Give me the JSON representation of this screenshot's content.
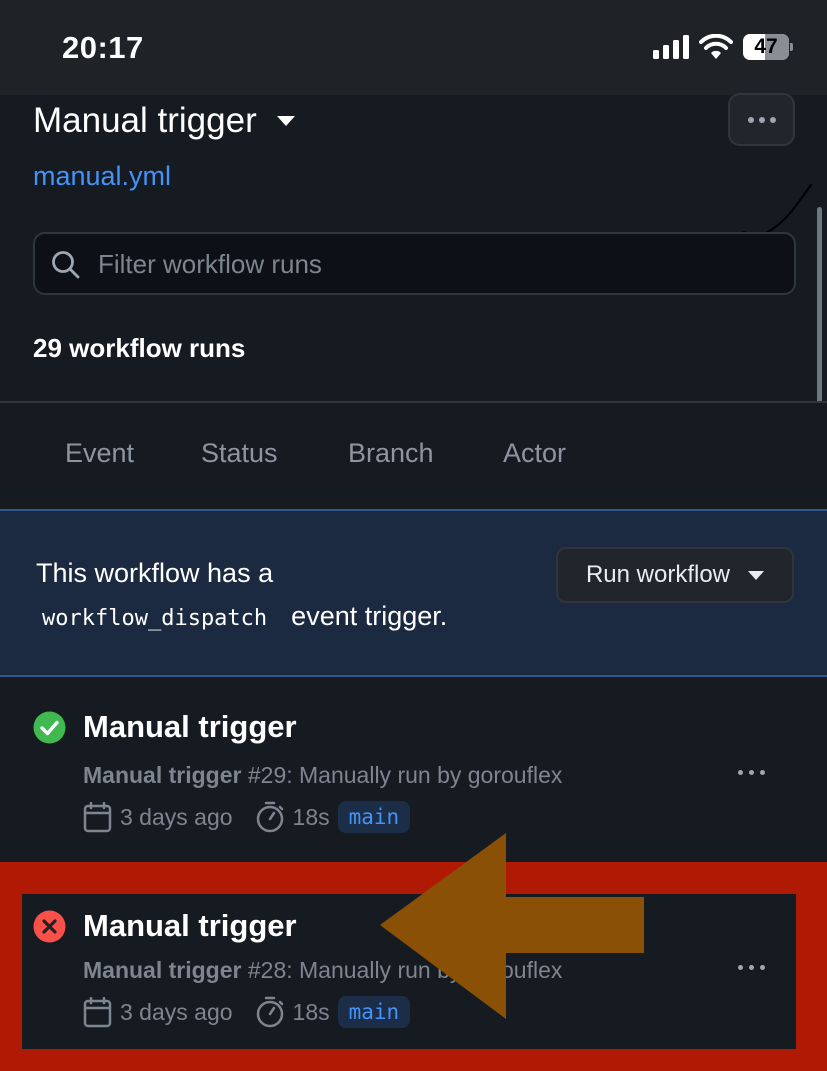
{
  "status_bar": {
    "time": "20:17",
    "battery": "47"
  },
  "header": {
    "title": "Manual trigger",
    "file_link": "manual.yml",
    "search": {
      "placeholder": "Filter workflow runs",
      "value": ""
    },
    "runs_count": "29 workflow runs"
  },
  "filters": [
    "Event",
    "Status",
    "Branch",
    "Actor"
  ],
  "dispatch": {
    "line1": "This workflow has a",
    "code": "workflow_dispatch",
    "line2_tail": "event trigger.",
    "button_label": "Run workflow"
  },
  "runs": [
    {
      "status": "success",
      "title": "Manual trigger",
      "workflow": "Manual trigger",
      "detail": " #29: Manually run by gorouflex",
      "age": "3 days ago",
      "duration": "18s",
      "branch": "main"
    },
    {
      "status": "failure",
      "title": "Manual trigger",
      "workflow": "Manual trigger",
      "detail": " #28: Manually run by gorouflex",
      "age": "3 days ago",
      "duration": "18s",
      "branch": "main"
    }
  ],
  "colors": {
    "accent_link": "#4493f8",
    "success": "#3fb950",
    "failure": "#f85149",
    "highlight_annotation": "#b01a05",
    "arrow_annotation": "#8a5006"
  }
}
